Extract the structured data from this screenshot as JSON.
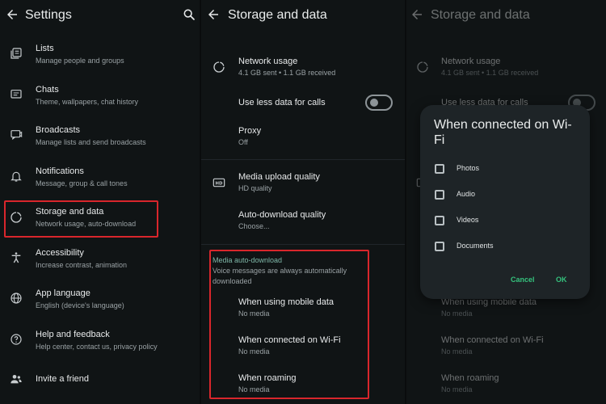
{
  "settings": {
    "title": "Settings",
    "items": [
      {
        "label": "Lists",
        "sub": "Manage people and groups",
        "icon": "lists-icon"
      },
      {
        "label": "Chats",
        "sub": "Theme, wallpapers, chat history",
        "icon": "chat-icon"
      },
      {
        "label": "Broadcasts",
        "sub": "Manage lists and send broadcasts",
        "icon": "broadcast-icon"
      },
      {
        "label": "Notifications",
        "sub": "Message, group & call tones",
        "icon": "bell-icon"
      },
      {
        "label": "Storage and data",
        "sub": "Network usage, auto-download",
        "icon": "storage-icon"
      },
      {
        "label": "Accessibility",
        "sub": "Increase contrast, animation",
        "icon": "accessibility-icon"
      },
      {
        "label": "App language",
        "sub": "English (device's language)",
        "icon": "globe-icon"
      },
      {
        "label": "Help and feedback",
        "sub": "Help center, contact us, privacy policy",
        "icon": "help-icon"
      },
      {
        "label": "Invite a friend",
        "sub": "",
        "icon": "invite-icon"
      }
    ]
  },
  "storage": {
    "title": "Storage and data",
    "network_usage": {
      "label": "Network usage",
      "sub": "4.1 GB sent • 1.1 GB received"
    },
    "less_data": {
      "label": "Use less data for calls",
      "enabled": false
    },
    "proxy": {
      "label": "Proxy",
      "sub": "Off"
    },
    "upload_quality": {
      "label": "Media upload quality",
      "sub": "HD quality"
    },
    "auto_download_quality": {
      "label": "Auto-download quality",
      "sub": "Choose..."
    },
    "auto_download": {
      "header": "Media auto-download",
      "description": "Voice messages are always automatically downloaded",
      "mobile": {
        "label": "When using mobile data",
        "sub": "No media"
      },
      "wifi": {
        "label": "When connected on Wi-Fi",
        "sub": "No media"
      },
      "roaming": {
        "label": "When roaming",
        "sub": "No media"
      }
    }
  },
  "dialog": {
    "title": "When connected on Wi-Fi",
    "options": [
      {
        "label": "Photos",
        "checked": false
      },
      {
        "label": "Audio",
        "checked": false
      },
      {
        "label": "Videos",
        "checked": false
      },
      {
        "label": "Documents",
        "checked": false
      }
    ],
    "cancel": "Cancel",
    "ok": "OK"
  },
  "colors": {
    "background": "#101415",
    "highlight": "#d9262c",
    "accent": "#35c27d",
    "section_header": "#7fb7a8"
  }
}
